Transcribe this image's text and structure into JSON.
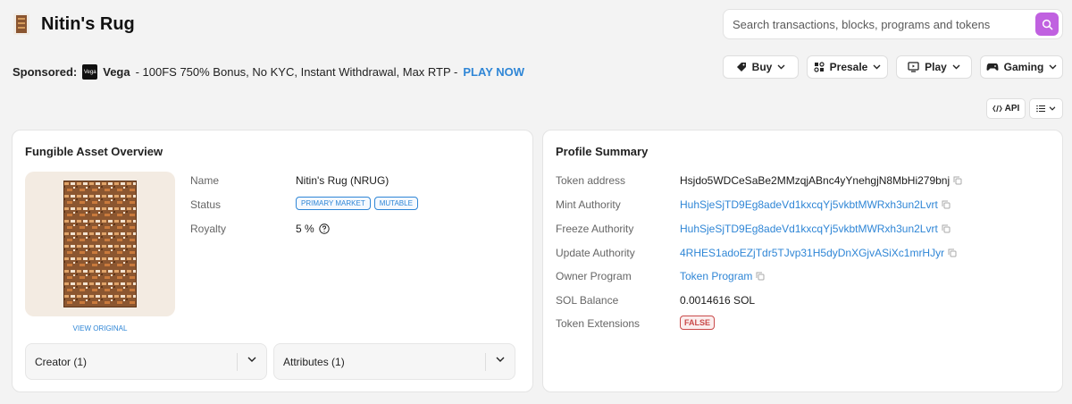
{
  "header": {
    "title": "Nitin's Rug",
    "thumb_icon": "rug-thumbnail"
  },
  "search": {
    "placeholder": "Search transactions, blocks, programs and tokens",
    "icon": "search-icon",
    "accent": "#c061e0"
  },
  "sponsor": {
    "label": "Sponsored:",
    "brand_logo_text": "Vega",
    "brand": "Vega",
    "text": "- 100FS 750% Bonus, No KYC, Instant Withdrawal, Max RTP -",
    "cta": "PLAY NOW"
  },
  "nav_buttons": [
    {
      "label": "Buy",
      "icon": "tag-icon"
    },
    {
      "label": "Presale",
      "icon": "presale-icon"
    },
    {
      "label": "Play",
      "icon": "monitor-icon"
    },
    {
      "label": "Gaming",
      "icon": "gamepad-icon"
    }
  ],
  "toolbar": {
    "api_label": "API",
    "list_icon": "list-icon"
  },
  "overview": {
    "title": "Fungible Asset Overview",
    "view_original": "VIEW ORIGINAL",
    "fields": {
      "name_label": "Name",
      "name_value": "Nitin's Rug (NRUG)",
      "status_label": "Status",
      "status_badges": [
        "PRIMARY MARKET",
        "MUTABLE"
      ],
      "royalty_label": "Royalty",
      "royalty_value": "5 %"
    },
    "accordions": [
      {
        "label": "Creator (1)"
      },
      {
        "label": "Attributes (1)"
      }
    ]
  },
  "profile": {
    "title": "Profile Summary",
    "rows": [
      {
        "label": "Token address",
        "value": "Hsjdo5WDCeSaBe2MMzqjABnc4yYnehgjN8MbHi279bnj"
      },
      {
        "label": "Mint Authority",
        "value": "HuhSjeSjTD9Eg8adeVd1kxcqYj5vkbtMWRxh3un2Lvrt"
      },
      {
        "label": "Freeze Authority",
        "value": "HuhSjeSjTD9Eg8adeVd1kxcqYj5vkbtMWRxh3un2Lvrt"
      },
      {
        "label": "Update Authority",
        "value": "4RHES1adoEZjTdr5TJvp31H5dyDnXGjvASiXc1mrHJyr"
      },
      {
        "label": "Owner Program",
        "value": "Token Program"
      },
      {
        "label": "SOL Balance",
        "value": "0.0014616 SOL"
      },
      {
        "label": "Token Extensions",
        "value": "FALSE"
      }
    ]
  }
}
